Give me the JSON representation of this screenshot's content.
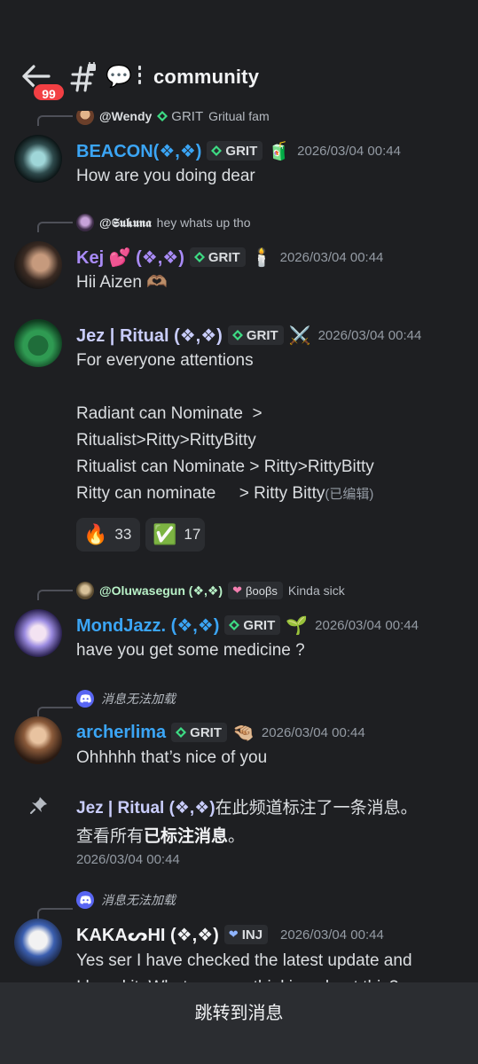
{
  "header": {
    "badge_count": "99",
    "channel_name": "community",
    "speech_icon": "💬"
  },
  "messages": [
    {
      "reply": {
        "name": "@Wendy",
        "tag": "GRIT",
        "text": "Gritual fam"
      },
      "author": "BEACON(❖,❖)",
      "author_color": "#3ba5f5",
      "tag": "GRIT",
      "emoji": "🧃",
      "time": "2026/03/04 00:44",
      "lines": [
        "How are you doing dear"
      ]
    },
    {
      "reply": {
        "name": "@𝕾𝖚𝖐𝖚𝖓𝖆",
        "text": "hey whats up tho"
      },
      "author": "Kej 💕 (❖,❖)",
      "author_color": "#a98bf7",
      "tag": "GRIT",
      "emoji": "🕯️",
      "time": "2026/03/04 00:44",
      "lines": [
        "Hii Aizen 🫶🏽"
      ]
    },
    {
      "author": "Jez | Ritual (❖,❖)",
      "author_color": "#c9cdfb",
      "tag": "GRIT",
      "emoji": "⚔️",
      "time": "2026/03/04 00:44",
      "lines": [
        "For everyone attentions",
        "",
        "Radiant can Nominate  >",
        "Ritualist>Ritty>RittyBitty",
        "Ritualist can Nominate > Ritty>RittyBitty",
        "Ritty can nominate     > Ritty Bitty"
      ],
      "edited": "(已编辑)",
      "reactions": [
        {
          "emoji": "🔥",
          "count": "33"
        },
        {
          "emoji": "✅",
          "count": "17"
        }
      ]
    },
    {
      "reply": {
        "name": "@Oluwasegun (❖,❖)",
        "tag": "βοοβs",
        "text": "Kinda sick"
      },
      "author": "MondJazz. (❖,❖)",
      "author_color": "#3ba5f5",
      "tag": "GRIT",
      "emoji": "🌱",
      "time": "2026/03/04 00:44",
      "lines": [
        "have you get some medicine ?"
      ]
    },
    {
      "reply": {
        "unloaded": "消息无法加载"
      },
      "author": "archerlima",
      "author_color": "#3ba5f5",
      "tag": "GRIT",
      "emoji": "🤏🏼",
      "time": "2026/03/04 00:44",
      "lines": [
        "Ohhhhh that’s nice of you"
      ]
    },
    {
      "reply": {
        "unloaded": "消息无法加载"
      },
      "author": "KAKAᔕHI (❖,❖)",
      "author_color": "#f2f3f5",
      "tag": "INJ",
      "time": "2026/03/04 00:44",
      "lines": [
        "Yes ser I have checked the latest update and",
        "I loved it. What are you thinking about this?"
      ]
    }
  ],
  "system_pin": {
    "author": "Jez | Ritual (❖,❖)",
    "text_1": "在此频道标注了一条消息。",
    "text_2": "查看所有",
    "link": "已标注消息",
    "text_3": "。",
    "time": "2026/03/04 00:44"
  },
  "footer": {
    "jump_label": "跳转到消息"
  },
  "colors": {
    "background": "#1e1f22",
    "bubble": "#2b2d31",
    "blue_name": "#3ba5f5",
    "badge_red": "#f23f43"
  }
}
